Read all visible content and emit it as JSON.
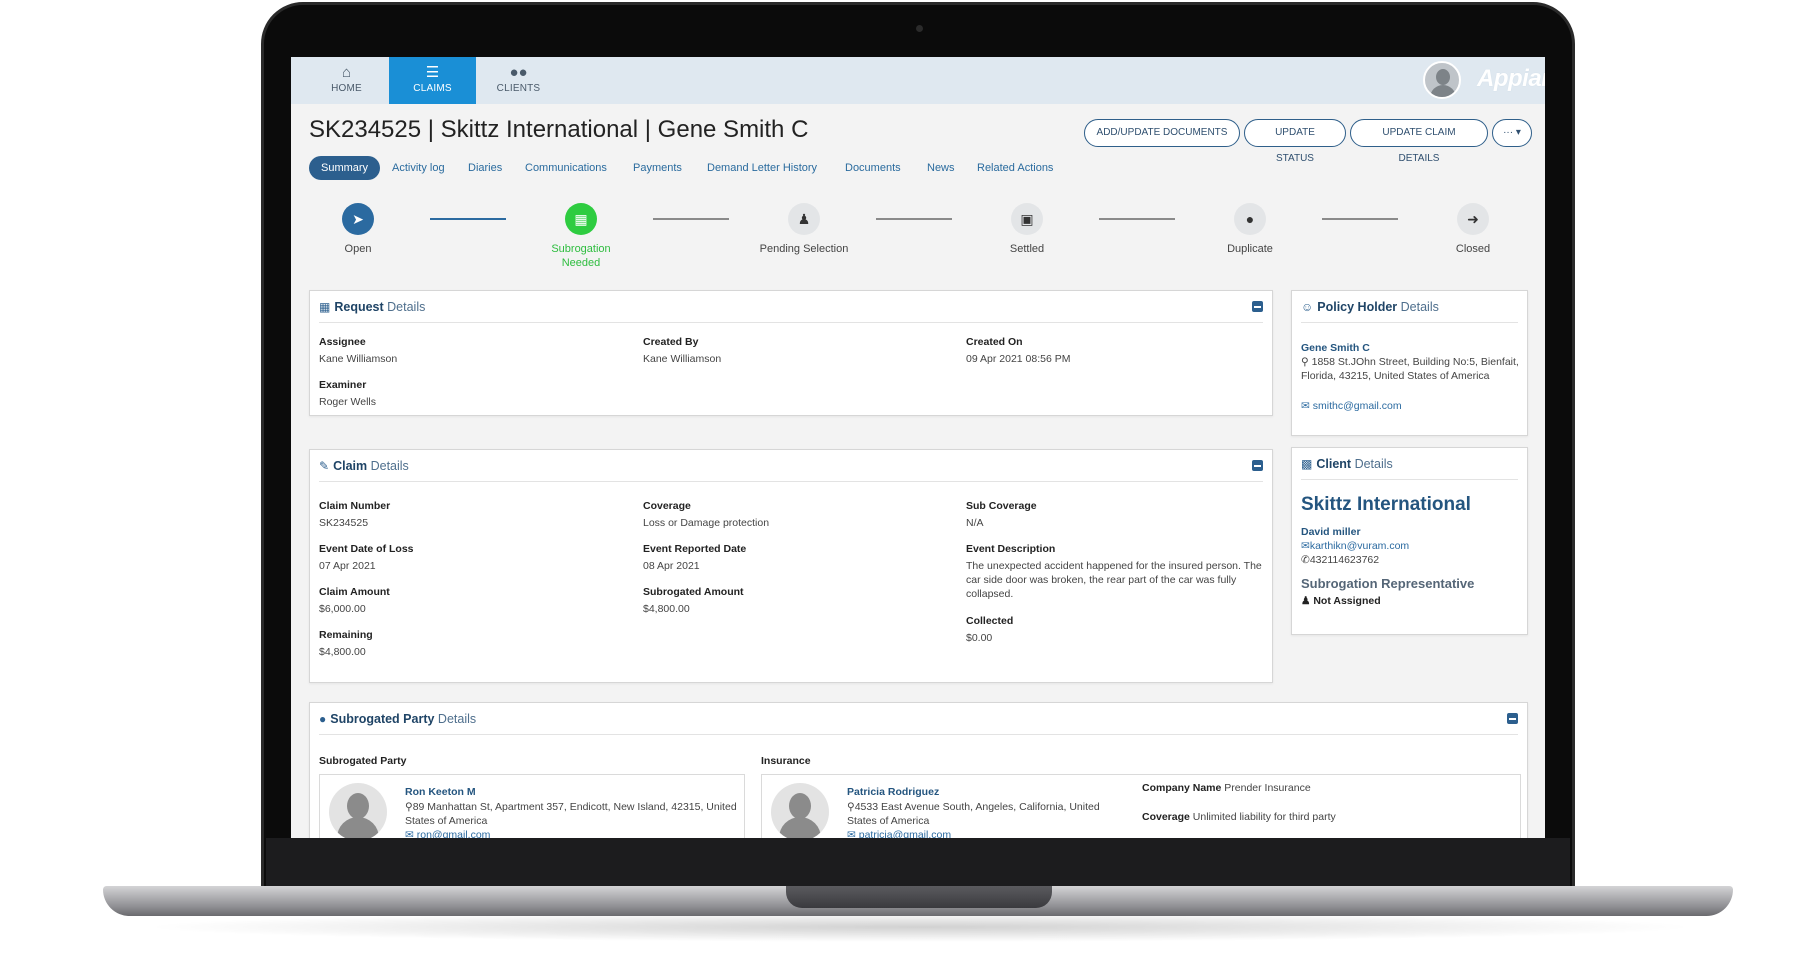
{
  "nav": {
    "home": "HOME",
    "claims": "CLAIMS",
    "clients": "CLIENTS",
    "brand": "Appian"
  },
  "header": {
    "title": "SK234525 | Skittz International | Gene Smith C",
    "actions": [
      "ADD/UPDATE DOCUMENTS",
      "UPDATE STATUS",
      "UPDATE CLAIM DETAILS",
      "···"
    ]
  },
  "tabs": [
    "Summary",
    "Activity log",
    "Diaries",
    "Communications",
    "Payments",
    "Demand Letter History",
    "Documents",
    "News",
    "Related Actions"
  ],
  "steps": [
    {
      "label": "Open",
      "icon": "paper-plane-icon",
      "state": "done"
    },
    {
      "label": "Subrogation Needed",
      "icon": "document-icon",
      "state": "current"
    },
    {
      "label": "Pending Selection",
      "icon": "user-tie-icon",
      "state": "pending"
    },
    {
      "label": "Settled",
      "icon": "briefcase-icon",
      "state": "pending"
    },
    {
      "label": "Duplicate",
      "icon": "users-icon",
      "state": "pending"
    },
    {
      "label": "Closed",
      "icon": "sign-in-icon",
      "state": "pending"
    }
  ],
  "request": {
    "title_bold": "Request",
    "title_rest": "Details",
    "assignee_label": "Assignee",
    "assignee": "Kane Williamson",
    "examiner_label": "Examiner",
    "examiner": "Roger Wells",
    "created_by_label": "Created By",
    "created_by": "Kane Williamson",
    "created_on_label": "Created On",
    "created_on": "09 Apr 2021 08:56 PM"
  },
  "claim": {
    "title_bold": "Claim",
    "title_rest": "Details",
    "claim_number_label": "Claim Number",
    "claim_number": "SK234525",
    "event_date_label": "Event Date of Loss",
    "event_date": "07 Apr 2021",
    "claim_amount_label": "Claim Amount",
    "claim_amount": "$6,000.00",
    "remaining_label": "Remaining",
    "remaining": "$4,800.00",
    "coverage_label": "Coverage",
    "coverage": "Loss or Damage protection",
    "reported_label": "Event Reported Date",
    "reported": "08 Apr 2021",
    "subrogated_label": "Subrogated Amount",
    "subrogated": "$4,800.00",
    "sub_coverage_label": "Sub Coverage",
    "sub_coverage": "N/A",
    "description_label": "Event Description",
    "description": "The unexpected accident happened for the insured person. The car side door was broken, the rear part of the car was fully collapsed.",
    "collected_label": "Collected",
    "collected": "$0.00"
  },
  "policy_holder": {
    "title_bold": "Policy Holder",
    "title_rest": "Details",
    "name": "Gene Smith C",
    "address": "1858 St.JOhn Street, Building No:5, Bienfait, Florida, 43215, United States of America",
    "email": "smithc@gmail.com"
  },
  "client": {
    "title_bold": "Client",
    "title_rest": "Details",
    "company": "Skittz International",
    "contact": "David miller",
    "email": "karthikn@vuram.com",
    "phone": "432114623762",
    "rep_label": "Subrogation Representative",
    "rep_value": "Not Assigned"
  },
  "subrogated_party": {
    "title_bold": "Subrogated Party",
    "title_rest": "Details",
    "party_label": "Subrogated Party",
    "insurance_label": "Insurance",
    "party_name": "Ron Keeton M",
    "party_address": "89 Manhattan St, Apartment 357, Endicott, New Island, 42315, United States of America",
    "party_email": "ron@gmail.com",
    "ins_name": "Patricia Rodriguez",
    "ins_address": "4533 East Avenue South, Angeles, California, United States of America",
    "ins_email": "patricia@gmail.com",
    "company_name_label": "Company Name",
    "company_name": "Prender Insurance",
    "coverage_label": "Coverage",
    "coverage": "Unlimited liability for third party"
  }
}
